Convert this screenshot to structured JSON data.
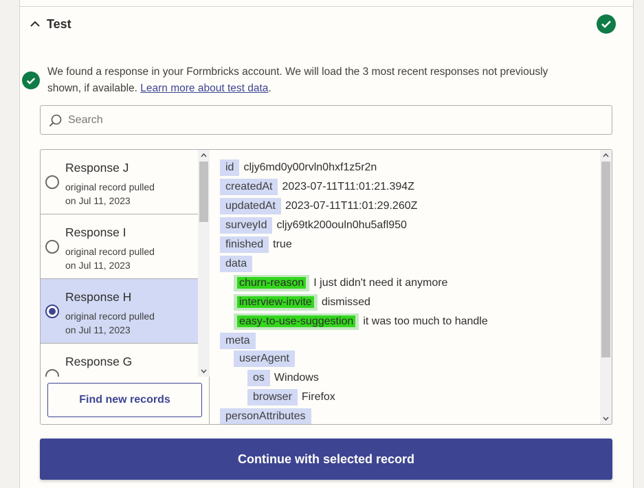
{
  "section": {
    "title": "Test"
  },
  "message": {
    "text": "We found a response in your Formbricks account. We will load the 3 most recent responses not previously shown, if available. ",
    "link": "Learn more about test data",
    "end": "."
  },
  "search": {
    "placeholder": "Search",
    "value": ""
  },
  "records": [
    {
      "title": "Response J",
      "line1": "original record pulled",
      "line2": "on Jul 11, 2023",
      "selected": false
    },
    {
      "title": "Response I",
      "line1": "original record pulled",
      "line2": "on Jul 11, 2023",
      "selected": false
    },
    {
      "title": "Response H",
      "line1": "original record pulled",
      "line2": "on Jul 11, 2023",
      "selected": true
    },
    {
      "title": "Response G",
      "line1": "",
      "line2": "",
      "selected": false
    }
  ],
  "find_button": "Find new records",
  "detail": {
    "id": {
      "key": "id",
      "value": "cljy6md0y00rvln0hxf1z5r2n"
    },
    "createdAt": {
      "key": "createdAt",
      "value": "2023-07-11T11:01:21.394Z"
    },
    "updatedAt": {
      "key": "updatedAt",
      "value": "2023-07-11T11:01:29.260Z"
    },
    "surveyId": {
      "key": "surveyId",
      "value": "cljy69tk200ouln0hu5afl950"
    },
    "finished": {
      "key": "finished",
      "value": "true"
    },
    "data": {
      "key": "data"
    },
    "churn": {
      "key": "churn-reason",
      "value": "I just didn't need it anymore"
    },
    "interview": {
      "key": "interview-invite",
      "value": "dismissed"
    },
    "easy": {
      "key": "easy-to-use-suggestion",
      "value": "it was too much to handle"
    },
    "meta": {
      "key": "meta"
    },
    "userAgent": {
      "key": "userAgent"
    },
    "os": {
      "key": "os",
      "value": "Windows"
    },
    "browser": {
      "key": "browser",
      "value": "Firefox"
    },
    "personAttributes": {
      "key": "personAttributes"
    }
  },
  "continue_button": "Continue with selected record",
  "colors": {
    "accent": "#3d4592",
    "success": "#0f7b46",
    "selected_row": "#d2d9f4",
    "highlight": "#33d71c"
  }
}
